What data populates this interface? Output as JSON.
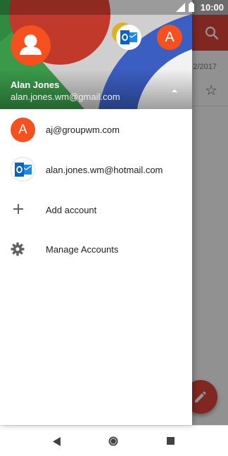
{
  "status_bar": {
    "time": "10:00"
  },
  "background_app": {
    "date": "2/2017"
  },
  "drawer": {
    "header": {
      "name": "Alan Jones",
      "email": "alan.jones.wm@gmail.com",
      "mini_avatar_letter": "A"
    },
    "accounts": [
      {
        "letter": "A",
        "label": "aj@groupwm.com"
      },
      {
        "label": "alan.jones.wm@hotmail.com"
      }
    ],
    "actions": [
      {
        "icon": "plus-icon",
        "label": "Add account"
      },
      {
        "icon": "gear-icon",
        "label": "Manage Accounts"
      }
    ]
  },
  "colors": {
    "accent": "#f4511e",
    "toolbar": "#db4437",
    "outlook_blue": "#0a64c8"
  }
}
